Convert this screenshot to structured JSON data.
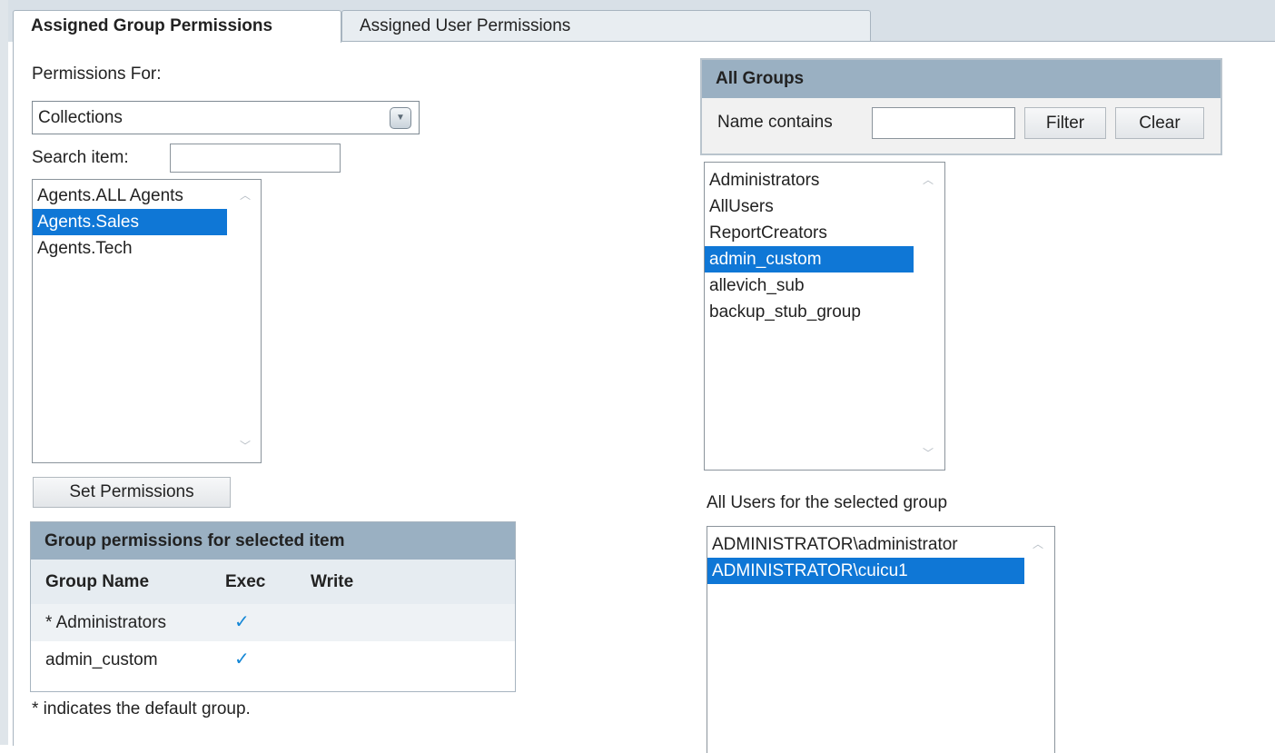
{
  "tabs": [
    {
      "label": "Assigned Group Permissions",
      "active": true
    },
    {
      "label": "Assigned User Permissions",
      "active": false
    }
  ],
  "left": {
    "permissions_for_label": "Permissions For:",
    "permissions_for_value": "Collections",
    "search_label": "Search item:",
    "search_value": "",
    "items": [
      "Agents.ALL Agents",
      "Agents.Sales",
      "Agents.Tech"
    ],
    "selected_item": "Agents.Sales",
    "set_permissions_label": "Set Permissions"
  },
  "group_permissions": {
    "title": "Group permissions for selected item",
    "columns": [
      "Group Name",
      "Exec",
      "Write"
    ],
    "rows": [
      {
        "name": "* Administrators",
        "exec": true,
        "write": false
      },
      {
        "name": "admin_custom",
        "exec": true,
        "write": false
      }
    ],
    "footnote": "* indicates the default group."
  },
  "all_groups": {
    "title": "All Groups",
    "name_contains_label": "Name contains",
    "name_contains_value": "",
    "filter_label": "Filter",
    "clear_label": "Clear",
    "groups": [
      "Administrators",
      "AllUsers",
      "ReportCreators",
      "admin_custom",
      "allevich_sub",
      "backup_stub_group"
    ],
    "selected_group": "admin_custom"
  },
  "users": {
    "label": "All Users for the selected group",
    "items": [
      "ADMINISTRATOR\\administrator",
      "ADMINISTRATOR\\cuicu1"
    ],
    "selected_user": "ADMINISTRATOR\\cuicu1"
  },
  "icons": {
    "check": "checkmark-icon",
    "dropdown": "chevron-down-icon",
    "scroll_up": "scroll-up-icon",
    "scroll_down": "scroll-down-icon"
  },
  "colors": {
    "selection": "#0f77d6",
    "header": "#9ab0c2",
    "check": "#1487d6"
  }
}
